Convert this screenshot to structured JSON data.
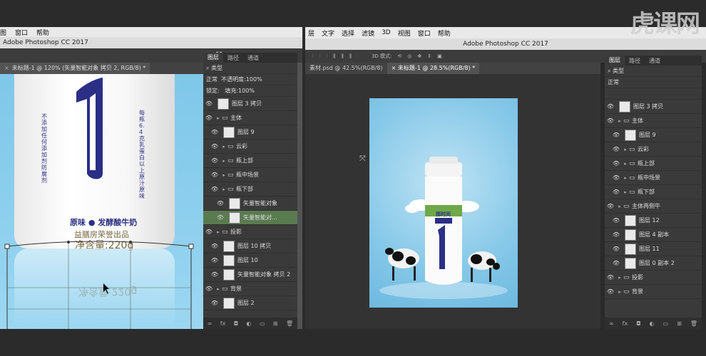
{
  "left": {
    "menu": [
      "图",
      "窗口",
      "帮助"
    ],
    "title": "Adobe Photoshop CC 2017",
    "tab": "未标题-1 @ 120% (矢量智能对象 拷贝 2, RGB/8) *",
    "bottle": {
      "brand_line": "原味",
      "product": "发酵酸牛奶",
      "slogan": "益膳房荣誉出品",
      "net": "净含量:220g",
      "reflect": "净含量:220g",
      "side_left": "不添加任何添加剂防腐剂",
      "side_right": "每瓶6.4克乳蛋白以上原汁原味"
    },
    "layers": {
      "tabs": [
        "图层",
        "路径",
        "通道"
      ],
      "filter": "类型",
      "blend": "正常",
      "opacity_label": "不透明度:",
      "opacity_value": "100%",
      "lock_label": "锁定:",
      "fill_label": "填充:",
      "fill_value": "100%",
      "items": [
        {
          "name": "图层 3 拷贝",
          "indent": 0
        },
        {
          "name": "主体",
          "indent": 0,
          "group": true
        },
        {
          "name": "图层 9",
          "indent": 1
        },
        {
          "name": "云彩",
          "indent": 1,
          "group": true
        },
        {
          "name": "瓶上部",
          "indent": 1,
          "group": true
        },
        {
          "name": "瓶中场景",
          "indent": 1,
          "group": true
        },
        {
          "name": "瓶下部",
          "indent": 1,
          "group": true
        },
        {
          "name": "矢量智能对象",
          "indent": 2
        },
        {
          "name": "矢量智能对...",
          "indent": 2
        },
        {
          "name": "投影",
          "indent": 0,
          "group": true
        },
        {
          "name": "图层 10 拷贝",
          "indent": 1
        },
        {
          "name": "图层 10",
          "indent": 1
        },
        {
          "name": "矢量智能对象 拷贝 2",
          "indent": 1
        },
        {
          "name": "背景",
          "indent": 0,
          "group": true
        },
        {
          "name": "图层 2",
          "indent": 1
        }
      ]
    }
  },
  "right": {
    "menu": [
      "层",
      "文字",
      "选择",
      "滤镜",
      "3D",
      "视图",
      "窗口",
      "帮助"
    ],
    "title": "Adobe Photoshop CC 2017",
    "options_label": "3D 模式:",
    "tabs": [
      "素材.psd @ 42.5%(RGB/8)",
      "未标题-1 @ 28.5%(RGB/8) *"
    ],
    "poster": {
      "brand": "那时间",
      "big_number": "1"
    },
    "layers": {
      "tabs": [
        "图层",
        "路径",
        "通道"
      ],
      "filter": "类型",
      "blend": "正常",
      "items": [
        {
          "name": "图层 3 拷贝",
          "indent": 0
        },
        {
          "name": "主体",
          "indent": 0,
          "group": true
        },
        {
          "name": "图层 9",
          "indent": 1
        },
        {
          "name": "云彩",
          "indent": 1,
          "group": true
        },
        {
          "name": "瓶上部",
          "indent": 1,
          "group": true
        },
        {
          "name": "瓶中场景",
          "indent": 1,
          "group": true
        },
        {
          "name": "瓶下部",
          "indent": 1,
          "group": true
        },
        {
          "name": "主体再侧牛",
          "indent": 0,
          "group": true
        },
        {
          "name": "图层 12",
          "indent": 1
        },
        {
          "name": "图层 4 副本",
          "indent": 1
        },
        {
          "name": "图层 11",
          "indent": 1
        },
        {
          "name": "图层 0 副本 2",
          "indent": 1
        },
        {
          "name": "投影",
          "indent": 0,
          "group": true
        },
        {
          "name": "背景",
          "indent": 0,
          "group": true
        }
      ]
    }
  },
  "watermark": "虎课网"
}
